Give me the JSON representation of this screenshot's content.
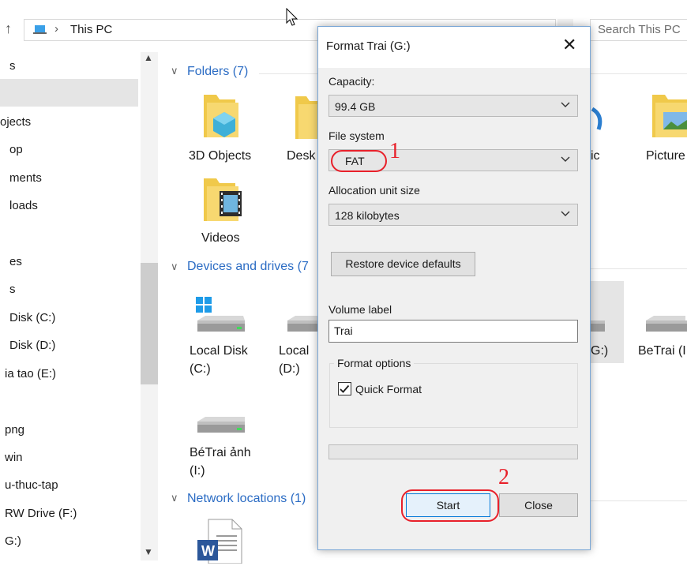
{
  "address": {
    "location": "This PC",
    "search_placeholder": "Search This PC"
  },
  "nav": {
    "items": [
      "s",
      "ojects",
      "op",
      "ments",
      "loads",
      "es",
      "s",
      "Disk (C:)",
      "Disk (D:)",
      "ia tao (E:)",
      "png",
      "win",
      "u-thuc-tap",
      "RW Drive (F:)",
      "G:)"
    ]
  },
  "content": {
    "folders_header": "Folders (7)",
    "folders": [
      "3D Objects",
      "Desk",
      "ic",
      "Picture",
      "Videos"
    ],
    "devices_header": "Devices and drives (7",
    "drives": [
      {
        "name": "Local Disk",
        "sub": "(C:)"
      },
      {
        "name": "Local",
        "sub": "(D:)"
      },
      {
        "name": "G:)",
        "sub": ""
      },
      {
        "name": "BeTrai (I",
        "sub": ""
      },
      {
        "name": "BéTrai ảnh",
        "sub": "(I:)"
      }
    ],
    "network_header": "Network locations (1)"
  },
  "dialog": {
    "title": "Format Trai (G:)",
    "capacity_label": "Capacity:",
    "capacity_value": "99.4 GB",
    "filesystem_label": "File system",
    "filesystem_value": "FAT",
    "alloc_label": "Allocation unit size",
    "alloc_value": "128 kilobytes",
    "restore_button": "Restore device defaults",
    "volume_label": "Volume label",
    "volume_value": "Trai",
    "format_options": "Format options",
    "quick_format": "Quick Format",
    "start_button": "Start",
    "close_button": "Close"
  },
  "annotations": {
    "marker1": "1",
    "marker2": "2",
    "color": "#e8202a"
  }
}
